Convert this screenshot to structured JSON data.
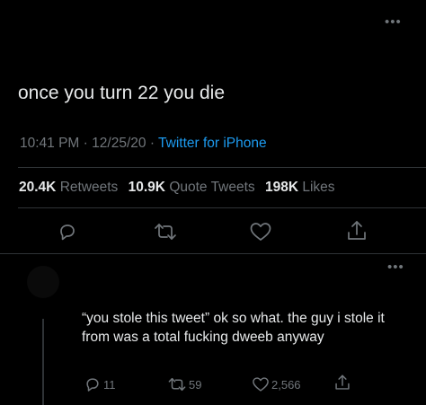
{
  "main_tweet": {
    "text": "once you turn 22 you die",
    "time": "10:41 PM",
    "date": "12/25/20",
    "separator": "·",
    "source": "Twitter for iPhone",
    "stats": {
      "retweets_count": "20.4K",
      "retweets_label": "Retweets",
      "quote_count": "10.9K",
      "quote_label": "Quote Tweets",
      "likes_count": "198K",
      "likes_label": "Likes"
    },
    "more_label": "•••"
  },
  "reply": {
    "text": "“you stole this tweet” ok so what. the guy i stole it from was a total fucking dweeb anyway",
    "replies": "11",
    "retweets": "59",
    "likes": "2,566",
    "more_label": "•••"
  },
  "colors": {
    "background": "#000000",
    "text": "#e7e9ea",
    "muted": "#71767b",
    "accent": "#1d9bf0",
    "divider": "#2f3336"
  },
  "icons": [
    "more-icon",
    "reply-icon",
    "retweet-icon",
    "like-icon",
    "share-icon"
  ]
}
